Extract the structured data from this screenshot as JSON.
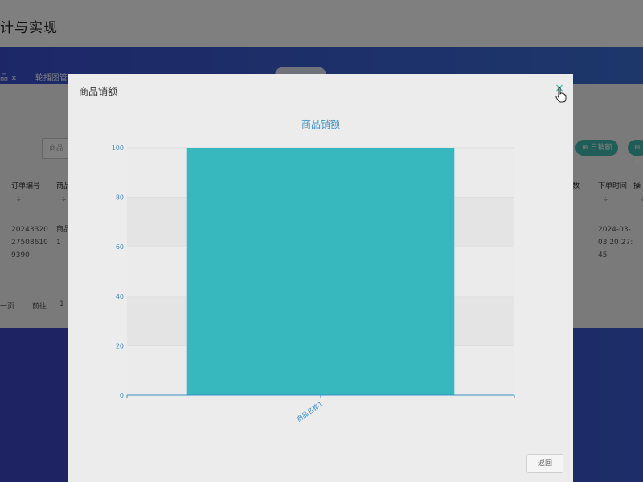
{
  "background": {
    "title": "计与实现",
    "tabs": [
      "品 ×",
      "轮播图管"
    ],
    "search_placeholder": "商品",
    "buttons": [
      "日销额",
      "统"
    ],
    "table_headers": [
      "订单编号",
      "商品",
      "数",
      "下单时间",
      "操"
    ],
    "sort_glyph": "≑",
    "row": {
      "order_id": [
        "20243320",
        "27508610",
        "9390"
      ],
      "product": [
        "商品",
        "1"
      ],
      "time": [
        "2024-03-",
        "03 20:27:",
        "45"
      ]
    },
    "pager": [
      "一页",
      "前往",
      "1"
    ]
  },
  "modal": {
    "title": "商品销额",
    "close_glyph": "×",
    "return_label": "返回"
  },
  "colors": {
    "bar": "#36b8be",
    "axis": "#3a8fc6",
    "accent": "#41b8b0"
  },
  "chart_data": {
    "type": "bar",
    "title": "商品销额",
    "categories": [
      "商品名称1"
    ],
    "values": [
      100
    ],
    "ylim": [
      0,
      100
    ],
    "yticks": [
      0,
      20,
      40,
      60,
      80,
      100
    ],
    "grid": true,
    "legend": "none"
  }
}
